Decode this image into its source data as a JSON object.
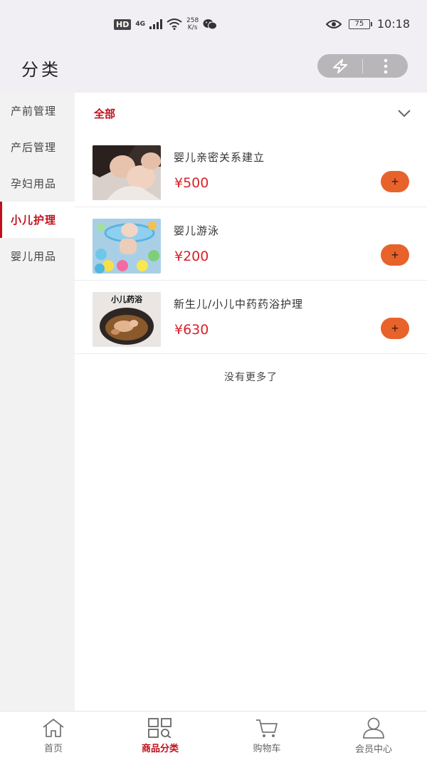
{
  "status_bar": {
    "hd": "HD",
    "network": "4G",
    "speed_value": "258",
    "speed_unit": "K/s",
    "battery": "75",
    "time": "10:18"
  },
  "header": {
    "title": "分类"
  },
  "sidebar": {
    "items": [
      {
        "label": "产前管理",
        "active": false
      },
      {
        "label": "产后管理",
        "active": false
      },
      {
        "label": "孕妇用品",
        "active": false
      },
      {
        "label": "小儿护理",
        "active": true
      },
      {
        "label": "婴儿用品",
        "active": false
      }
    ]
  },
  "filter": {
    "label": "全部"
  },
  "products": [
    {
      "name": "婴儿亲密关系建立",
      "price": "¥500",
      "add": "+"
    },
    {
      "name": "婴儿游泳",
      "price": "¥200",
      "add": "+"
    },
    {
      "name": "新生儿/小儿中药药浴护理",
      "price": "¥630",
      "add": "+",
      "thumb_text": "小儿药浴"
    }
  ],
  "no_more": "没有更多了",
  "tabbar": {
    "tabs": [
      {
        "label": "首页",
        "icon": "home-icon",
        "active": false
      },
      {
        "label": "商品分类",
        "icon": "category-search-icon",
        "active": true
      },
      {
        "label": "购物车",
        "icon": "cart-icon",
        "active": false
      },
      {
        "label": "会员中心",
        "icon": "user-icon",
        "active": false
      }
    ]
  },
  "colors": {
    "accent": "#c0101c",
    "price": "#d8222a",
    "add_button": "#e8622c",
    "header_bg": "#f2eff4",
    "sidebar_bg": "#f2f2f2"
  }
}
